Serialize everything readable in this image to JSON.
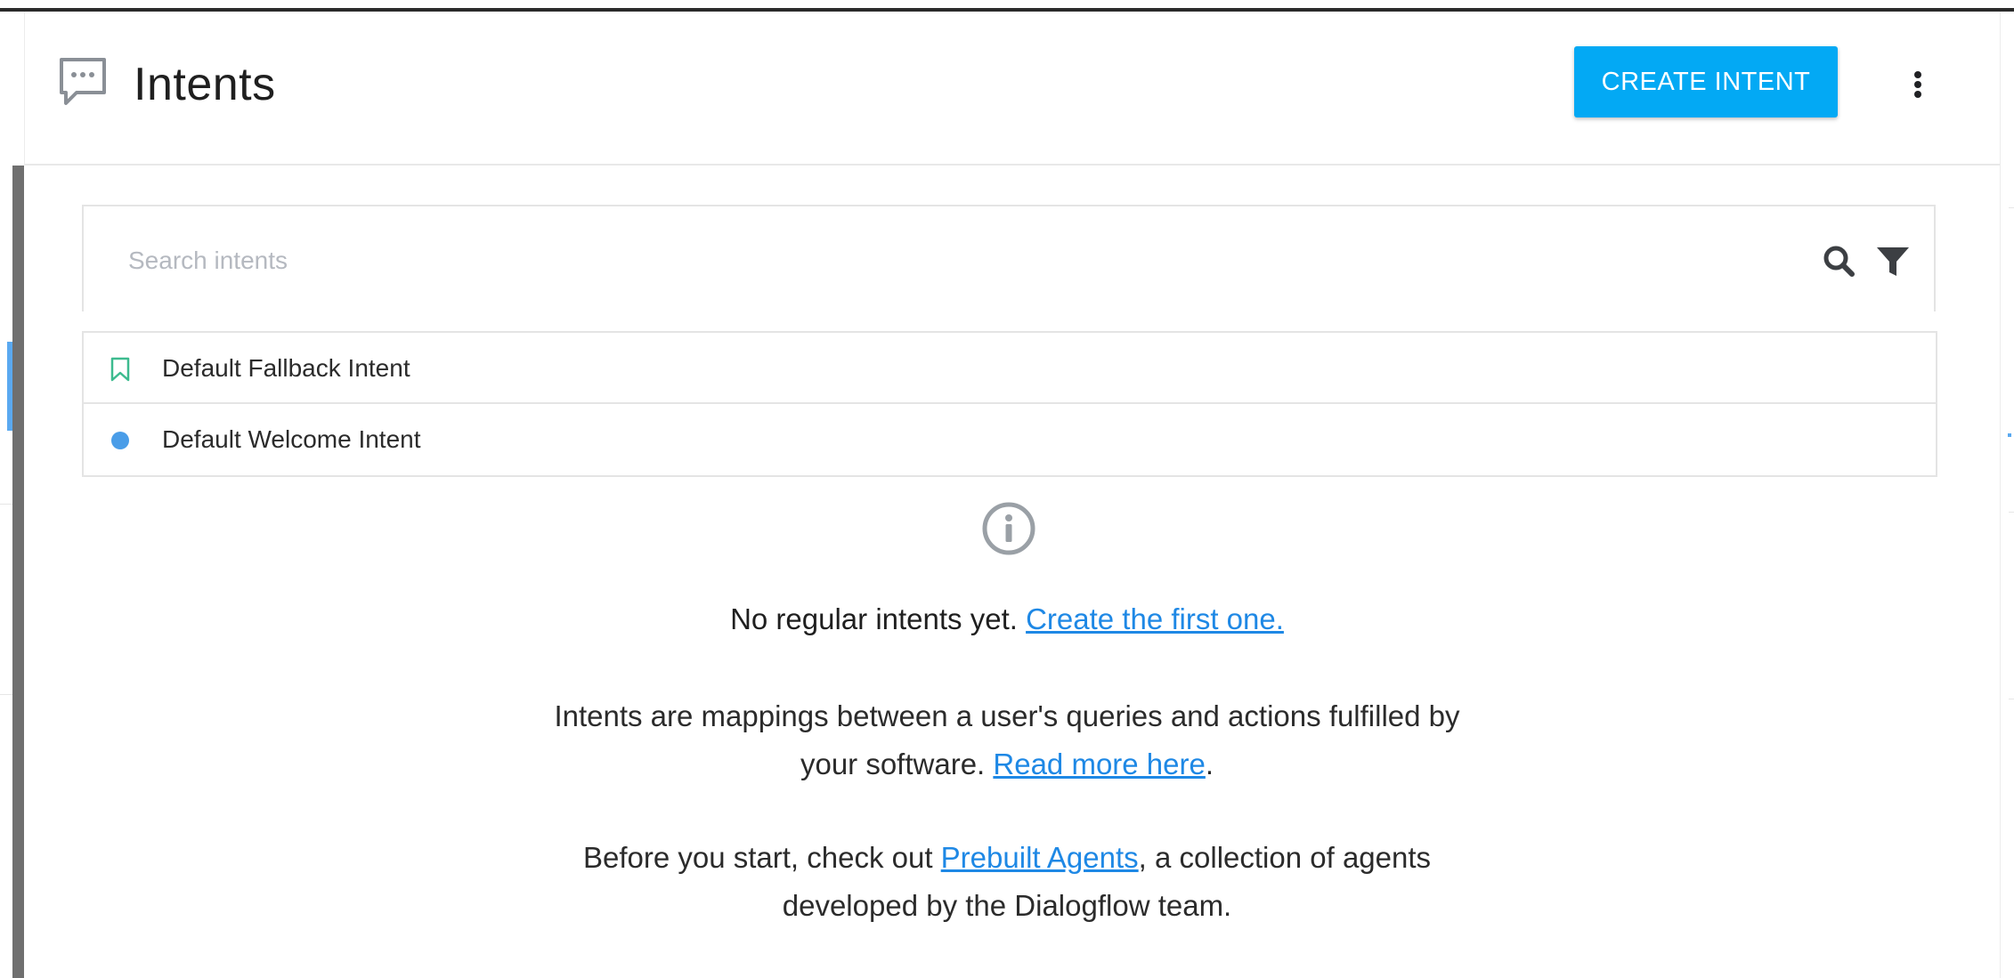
{
  "header": {
    "title": "Intents",
    "create_button": "CREATE INTENT"
  },
  "search": {
    "placeholder": "Search intents"
  },
  "intents": [
    {
      "label": "Default Fallback Intent",
      "icon": "bookmark-outline-icon",
      "color": "#3dbb8f"
    },
    {
      "label": "Default Welcome Intent",
      "icon": "filled-dot-icon",
      "color": "#4a9de8"
    }
  ],
  "empty_state": {
    "title_text": "No regular intents yet. ",
    "title_link": "Create the first one.",
    "para1_line1": "Intents are mappings between a user's queries and actions fulfilled by",
    "para1_line2_text": "your software. ",
    "para1_link": "Read more here",
    "para1_end": ".",
    "para2_line1_text": "Before you start, check out ",
    "para2_link": "Prebuilt Agents",
    "para2_line1_end": ", a collection of agents",
    "para2_line2": "developed by the Dialogflow team."
  },
  "colors": {
    "accent": "#03a9f4",
    "link": "#1e88e5"
  }
}
